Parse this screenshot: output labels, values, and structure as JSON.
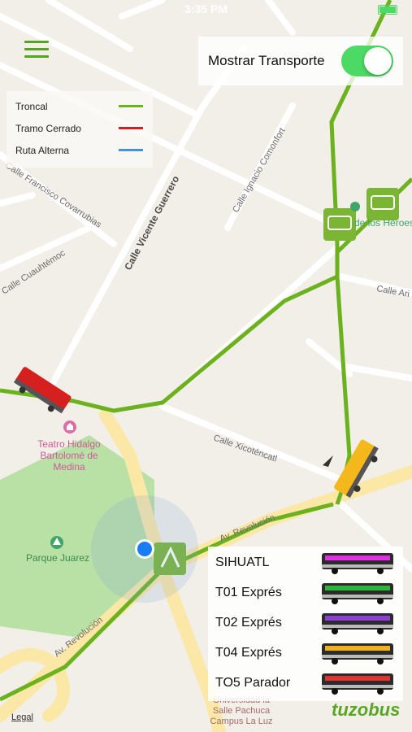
{
  "status": {
    "time": "3:35 PM"
  },
  "toggle": {
    "label": "Mostrar Transporte",
    "on": true
  },
  "legend": [
    {
      "label": "Troncal",
      "color": "#6cb21f"
    },
    {
      "label": "Tramo Cerrado",
      "color": "#d21f1f"
    },
    {
      "label": "Ruta Alterna",
      "color": "#4a90d9"
    }
  ],
  "streets": {
    "covarrubias": "Calle Francisco Covarrubias",
    "cuauhtemoc": "Calle Cuauhtémoc",
    "guerrero": "Calle Vicente Guerrero",
    "comonfort": "Calle Ignacio Comonfort",
    "xicotencatl": "Calle Xicoténcatl",
    "revolucion1": "Av. Revolución",
    "revolucion2": "Av. Revolución",
    "ari": "Calle Ari",
    "heroes": "de los Héroes"
  },
  "pois": {
    "teatro": [
      "Teatro Hidalgo",
      "Bartolomé de",
      "Medina"
    ],
    "parque": "Parque Juarez",
    "universidad": [
      "Universidad la",
      "Salle Pachuca",
      "Campus La Luz"
    ]
  },
  "routes": [
    {
      "label": "SIHUATL",
      "accent": "#e52ee5"
    },
    {
      "label": "T01 Exprés",
      "accent": "#2fb53b"
    },
    {
      "label": "T02 Exprés",
      "accent": "#8b3fd6"
    },
    {
      "label": "T04 Exprés",
      "accent": "#f0b21c"
    },
    {
      "label": "TO5 Parador",
      "accent": "#e53030"
    }
  ],
  "footer": {
    "legal": "Legal",
    "brand": "tuzobus"
  },
  "colors": {
    "trunk": "#6cb21f",
    "map_bg": "#f2efe8",
    "road": "#ffffff",
    "park": "#b8dfa0"
  }
}
